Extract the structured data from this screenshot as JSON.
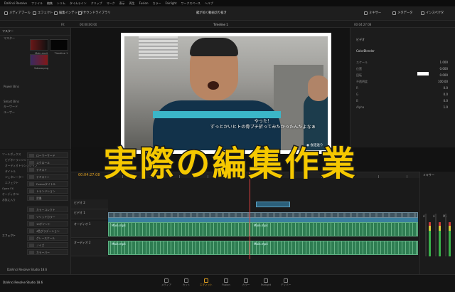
{
  "app": {
    "menu": [
      "DaVinci Resolve",
      "ファイル",
      "編集",
      "トリム",
      "タイムライン",
      "クリップ",
      "マーク",
      "表示",
      "再生",
      "Fusion",
      "カラー",
      "Fairlight",
      "ワークスペース",
      "ヘルプ"
    ],
    "project_title": "龍が如く動画切り抜き",
    "timeline_name": "Timeline 1",
    "footer_label": "DaVinci Resolve Studio 18.6"
  },
  "toolbar": {
    "media_pool": "メディアプール",
    "effects": "エフェクト",
    "edit_index": "編集インデックス",
    "sound_library": "サウンドライブラリ",
    "mixer": "ミキサー",
    "metadata": "メタデータ",
    "inspector": "インスペクタ",
    "timecode_top": "00:00:00:00",
    "zoom": "Fit",
    "timecode_right": "00:04:27:08"
  },
  "media_pool": {
    "header": "マスター",
    "sections": [
      "マスター",
      "Power Bins",
      "Smart Bins",
      "キーワード",
      "ユーザー"
    ],
    "clips": [
      {
        "name": "Main.mp4"
      },
      {
        "name": "Timeline 1"
      },
      {
        "name": "Yakuza.png"
      }
    ]
  },
  "effects": {
    "header": "エフェクト",
    "left_list": [
      "ツールボックス",
      "ビデオトランジション",
      "オーディオトランジション",
      "タイトル",
      "ジェネレーター",
      "エフェクト",
      "Open FX",
      "オーディオFX",
      "お気に入り"
    ],
    "items": [
      "ローワーサード",
      "スクロール",
      "テキスト",
      "テキスト+",
      "Fusionタイトル",
      "トランジション",
      "背景",
      "カラーコレクト",
      "ソリッドカラー",
      "10ポイント",
      "4色グラデーション",
      "グレースケール",
      "ノイズ",
      "カラーバー"
    ]
  },
  "viewer": {
    "subtitle_line1": "やった！",
    "subtitle_line2": "ずっとかいヒトの骨ブチ折ってみたかったんだよなぁ",
    "skip_label": "会話送り"
  },
  "inspector": {
    "tab": "ビデオ",
    "section": "ColorBlender",
    "rows": [
      {
        "label": "スケール",
        "value": "1.000"
      },
      {
        "label": "位置",
        "value": "0.000"
      },
      {
        "label": "回転",
        "value": "0.000"
      },
      {
        "label": "不透明度",
        "value": "100.00"
      },
      {
        "label": "R",
        "value": "0.0"
      },
      {
        "label": "G",
        "value": "0.0"
      },
      {
        "label": "B",
        "value": "0.0"
      },
      {
        "label": "Alpha",
        "value": "1.0"
      }
    ]
  },
  "overlay_title": "実際の編集作業",
  "timeline": {
    "timecode": "00:04:27:08",
    "tracks": [
      {
        "id": "V2",
        "label": "ビデオ 2"
      },
      {
        "id": "V1",
        "label": "ビデオ 1"
      },
      {
        "id": "A1",
        "label": "オーディオ 1"
      },
      {
        "id": "A2",
        "label": "オーディオ 2"
      }
    ],
    "clip_labels": [
      "Main.mp4",
      "Main.mp4",
      "Main.mp4",
      "Main.mp4"
    ]
  },
  "mixer": {
    "title": "ミキサー",
    "channels": [
      "A1",
      "A2",
      "M1"
    ]
  },
  "pages": [
    "メディア",
    "カット",
    "エディット",
    "Fusion",
    "カラー",
    "Fairlight",
    "デリバー"
  ],
  "active_page": "エディット",
  "colors": {
    "accent": "#e0a020",
    "title_yellow": "#f5c800",
    "audio_green": "#2e7d52",
    "video_blue": "#3a7f9e"
  }
}
